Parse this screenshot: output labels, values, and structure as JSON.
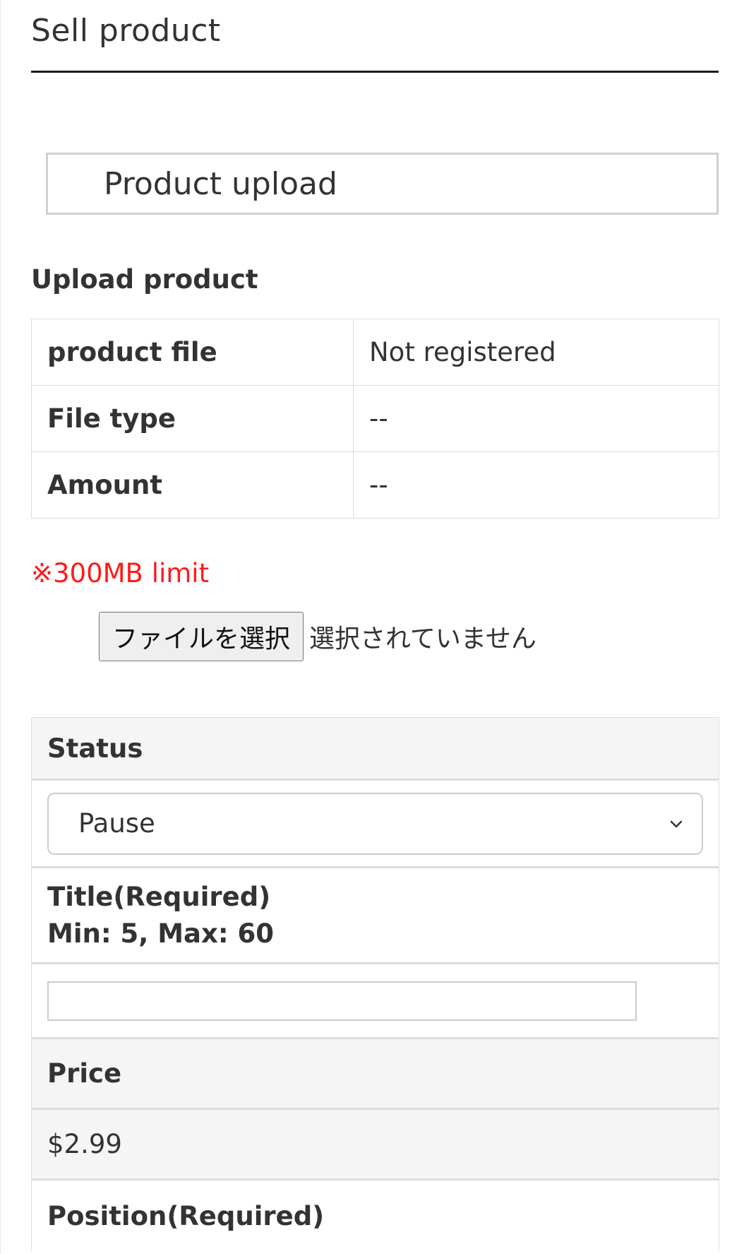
{
  "page": {
    "title": "Sell product"
  },
  "tab": {
    "label": "Product upload"
  },
  "upload_section": {
    "heading": "Upload product",
    "rows": [
      {
        "label": "product file",
        "value": "Not registered"
      },
      {
        "label": "File type",
        "value": "--"
      },
      {
        "label": "Amount",
        "value": "--"
      }
    ],
    "limit_note": "※300MB limit",
    "limit_color": "#ff1a1a",
    "file_button_label": "ファイルを選択",
    "file_status": "選択されていません"
  },
  "form": {
    "status": {
      "label": "Status",
      "selected": "Pause",
      "icon": "chevron-down-icon"
    },
    "title": {
      "label_line1": "Title(Required)",
      "label_line2": "Min: 5, Max: 60",
      "value": ""
    },
    "price": {
      "label": "Price",
      "value": "$2.99"
    },
    "position": {
      "label": "Position(Required)"
    }
  }
}
